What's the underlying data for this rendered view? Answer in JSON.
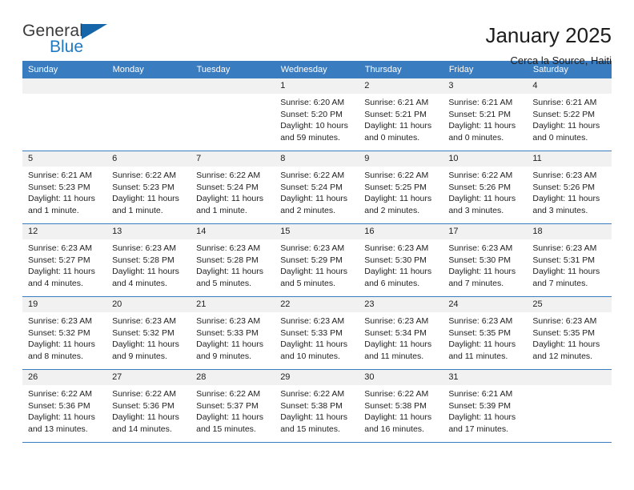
{
  "logo": {
    "word_top": "General",
    "word_bottom": "Blue",
    "triangle_color": "#1565a8",
    "blue_color": "#1f7ac4"
  },
  "header": {
    "title": "January 2025",
    "subtitle": "Cerca la Source, Haiti"
  },
  "colors": {
    "header_blue": "#3a7cc0",
    "daynum_gray": "#f1f1f1"
  },
  "weekday_headers": [
    "Sunday",
    "Monday",
    "Tuesday",
    "Wednesday",
    "Thursday",
    "Friday",
    "Saturday"
  ],
  "weeks": [
    [
      {
        "day": "",
        "lines": []
      },
      {
        "day": "",
        "lines": []
      },
      {
        "day": "",
        "lines": []
      },
      {
        "day": "1",
        "lines": [
          "Sunrise: 6:20 AM",
          "Sunset: 5:20 PM",
          "Daylight: 10 hours",
          "and 59 minutes."
        ]
      },
      {
        "day": "2",
        "lines": [
          "Sunrise: 6:21 AM",
          "Sunset: 5:21 PM",
          "Daylight: 11 hours",
          "and 0 minutes."
        ]
      },
      {
        "day": "3",
        "lines": [
          "Sunrise: 6:21 AM",
          "Sunset: 5:21 PM",
          "Daylight: 11 hours",
          "and 0 minutes."
        ]
      },
      {
        "day": "4",
        "lines": [
          "Sunrise: 6:21 AM",
          "Sunset: 5:22 PM",
          "Daylight: 11 hours",
          "and 0 minutes."
        ]
      }
    ],
    [
      {
        "day": "5",
        "lines": [
          "Sunrise: 6:21 AM",
          "Sunset: 5:23 PM",
          "Daylight: 11 hours",
          "and 1 minute."
        ]
      },
      {
        "day": "6",
        "lines": [
          "Sunrise: 6:22 AM",
          "Sunset: 5:23 PM",
          "Daylight: 11 hours",
          "and 1 minute."
        ]
      },
      {
        "day": "7",
        "lines": [
          "Sunrise: 6:22 AM",
          "Sunset: 5:24 PM",
          "Daylight: 11 hours",
          "and 1 minute."
        ]
      },
      {
        "day": "8",
        "lines": [
          "Sunrise: 6:22 AM",
          "Sunset: 5:24 PM",
          "Daylight: 11 hours",
          "and 2 minutes."
        ]
      },
      {
        "day": "9",
        "lines": [
          "Sunrise: 6:22 AM",
          "Sunset: 5:25 PM",
          "Daylight: 11 hours",
          "and 2 minutes."
        ]
      },
      {
        "day": "10",
        "lines": [
          "Sunrise: 6:22 AM",
          "Sunset: 5:26 PM",
          "Daylight: 11 hours",
          "and 3 minutes."
        ]
      },
      {
        "day": "11",
        "lines": [
          "Sunrise: 6:23 AM",
          "Sunset: 5:26 PM",
          "Daylight: 11 hours",
          "and 3 minutes."
        ]
      }
    ],
    [
      {
        "day": "12",
        "lines": [
          "Sunrise: 6:23 AM",
          "Sunset: 5:27 PM",
          "Daylight: 11 hours",
          "and 4 minutes."
        ]
      },
      {
        "day": "13",
        "lines": [
          "Sunrise: 6:23 AM",
          "Sunset: 5:28 PM",
          "Daylight: 11 hours",
          "and 4 minutes."
        ]
      },
      {
        "day": "14",
        "lines": [
          "Sunrise: 6:23 AM",
          "Sunset: 5:28 PM",
          "Daylight: 11 hours",
          "and 5 minutes."
        ]
      },
      {
        "day": "15",
        "lines": [
          "Sunrise: 6:23 AM",
          "Sunset: 5:29 PM",
          "Daylight: 11 hours",
          "and 5 minutes."
        ]
      },
      {
        "day": "16",
        "lines": [
          "Sunrise: 6:23 AM",
          "Sunset: 5:30 PM",
          "Daylight: 11 hours",
          "and 6 minutes."
        ]
      },
      {
        "day": "17",
        "lines": [
          "Sunrise: 6:23 AM",
          "Sunset: 5:30 PM",
          "Daylight: 11 hours",
          "and 7 minutes."
        ]
      },
      {
        "day": "18",
        "lines": [
          "Sunrise: 6:23 AM",
          "Sunset: 5:31 PM",
          "Daylight: 11 hours",
          "and 7 minutes."
        ]
      }
    ],
    [
      {
        "day": "19",
        "lines": [
          "Sunrise: 6:23 AM",
          "Sunset: 5:32 PM",
          "Daylight: 11 hours",
          "and 8 minutes."
        ]
      },
      {
        "day": "20",
        "lines": [
          "Sunrise: 6:23 AM",
          "Sunset: 5:32 PM",
          "Daylight: 11 hours",
          "and 9 minutes."
        ]
      },
      {
        "day": "21",
        "lines": [
          "Sunrise: 6:23 AM",
          "Sunset: 5:33 PM",
          "Daylight: 11 hours",
          "and 9 minutes."
        ]
      },
      {
        "day": "22",
        "lines": [
          "Sunrise: 6:23 AM",
          "Sunset: 5:33 PM",
          "Daylight: 11 hours",
          "and 10 minutes."
        ]
      },
      {
        "day": "23",
        "lines": [
          "Sunrise: 6:23 AM",
          "Sunset: 5:34 PM",
          "Daylight: 11 hours",
          "and 11 minutes."
        ]
      },
      {
        "day": "24",
        "lines": [
          "Sunrise: 6:23 AM",
          "Sunset: 5:35 PM",
          "Daylight: 11 hours",
          "and 11 minutes."
        ]
      },
      {
        "day": "25",
        "lines": [
          "Sunrise: 6:23 AM",
          "Sunset: 5:35 PM",
          "Daylight: 11 hours",
          "and 12 minutes."
        ]
      }
    ],
    [
      {
        "day": "26",
        "lines": [
          "Sunrise: 6:22 AM",
          "Sunset: 5:36 PM",
          "Daylight: 11 hours",
          "and 13 minutes."
        ]
      },
      {
        "day": "27",
        "lines": [
          "Sunrise: 6:22 AM",
          "Sunset: 5:36 PM",
          "Daylight: 11 hours",
          "and 14 minutes."
        ]
      },
      {
        "day": "28",
        "lines": [
          "Sunrise: 6:22 AM",
          "Sunset: 5:37 PM",
          "Daylight: 11 hours",
          "and 15 minutes."
        ]
      },
      {
        "day": "29",
        "lines": [
          "Sunrise: 6:22 AM",
          "Sunset: 5:38 PM",
          "Daylight: 11 hours",
          "and 15 minutes."
        ]
      },
      {
        "day": "30",
        "lines": [
          "Sunrise: 6:22 AM",
          "Sunset: 5:38 PM",
          "Daylight: 11 hours",
          "and 16 minutes."
        ]
      },
      {
        "day": "31",
        "lines": [
          "Sunrise: 6:21 AM",
          "Sunset: 5:39 PM",
          "Daylight: 11 hours",
          "and 17 minutes."
        ]
      },
      {
        "day": "",
        "lines": []
      }
    ]
  ]
}
